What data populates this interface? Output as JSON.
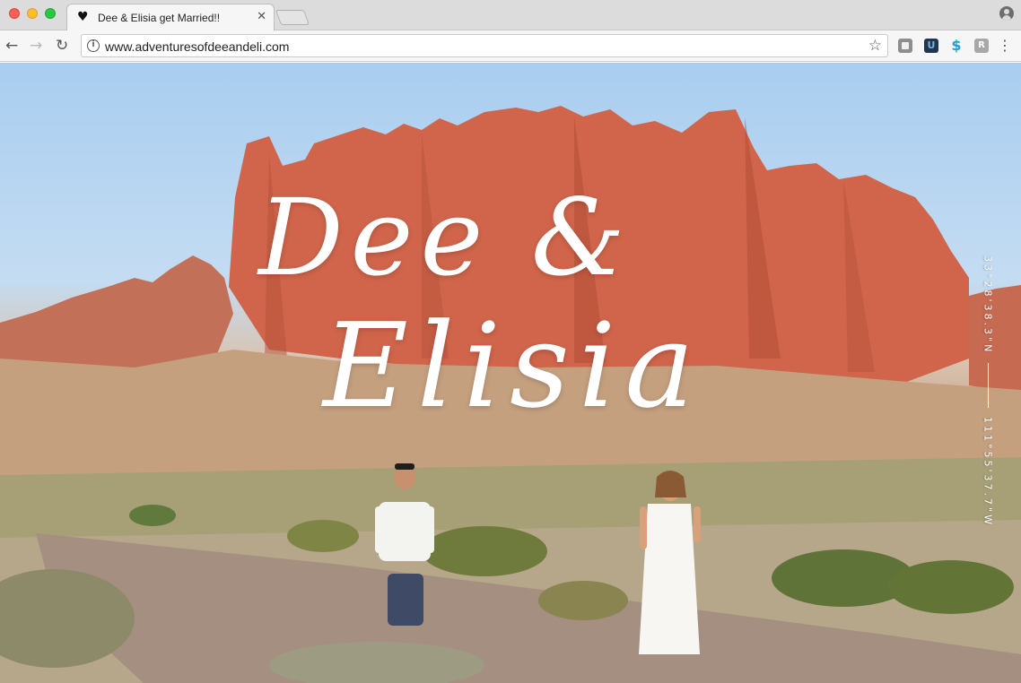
{
  "browser": {
    "tab": {
      "title": "Dee & Elisia get Married!!",
      "favicon_glyph": "♥",
      "close_glyph": "✕"
    },
    "url": "www.adventuresofdeeandeli.com",
    "icons": {
      "back": "←",
      "forward": "→",
      "reload": "↻",
      "info": "i",
      "bookmark": "☆",
      "menu": "⋮",
      "ext_2": "U",
      "ext_3": "$",
      "ext_4": "R"
    }
  },
  "hero": {
    "title_line1": "Dee &",
    "title_line2": "Elisia",
    "coordinates": {
      "latitude": "33°28'38.3\"N",
      "longitude": "111°55'37.7\"W"
    }
  }
}
